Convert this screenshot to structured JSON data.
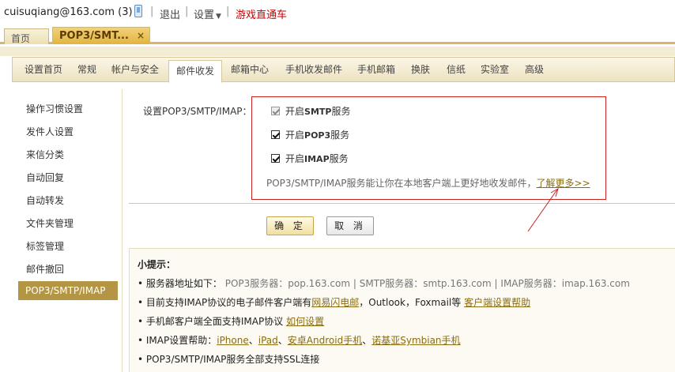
{
  "topbar": {
    "account": "cuisuqiang@163.com (3)",
    "logout": "退出",
    "settings": "设置",
    "game": "游戏直通车"
  },
  "window_tabs": [
    {
      "label": "首页"
    },
    {
      "label": "POP3/SMT..."
    }
  ],
  "settings_tabs": [
    "设置首页",
    "常规",
    "帐户与安全",
    "邮件收发",
    "邮箱中心",
    "手机收发邮件",
    "手机邮箱",
    "换肤",
    "信纸",
    "实验室",
    "高级"
  ],
  "left_nav": [
    "操作习惯设置",
    "发件人设置",
    "来信分类",
    "自动回复",
    "自动转发",
    "文件夹管理",
    "标签管理",
    "邮件撤回",
    "POP3/SMTP/IMAP"
  ],
  "form": {
    "label": "设置POP3/SMTP/IMAP：",
    "options": [
      {
        "prefix": "开启",
        "proto": "SMTP",
        "suffix": "服务",
        "checked": true,
        "disabled": true
      },
      {
        "prefix": "开启",
        "proto": "POP3",
        "suffix": "服务",
        "checked": true,
        "disabled": false
      },
      {
        "prefix": "开启",
        "proto": "IMAP",
        "suffix": "服务",
        "checked": true,
        "disabled": false
      }
    ],
    "desc": "POP3/SMTP/IMAP服务能让你在本地客户端上更好地收发邮件，",
    "more": "了解更多>>",
    "ok": "确 定",
    "cancel": "取 消"
  },
  "tips": {
    "title": "小提示：",
    "line1": {
      "prefix": "• 服务器地址如下：",
      "pop3": "POP3服务器：pop.163.com",
      "smtp": "SMTP服务器：smtp.163.com",
      "imap": "IMAP服务器：imap.163.com",
      "bar": "|"
    },
    "line2": {
      "prefix": "• 目前支持IMAP协议的电子邮件客户端有",
      "link1": "网易闪电邮",
      "mid": "，Outlook，Foxmail等",
      "link2": "客户端设置帮助"
    },
    "line3": {
      "prefix": "• 手机邮客户端全面支持IMAP协议",
      "link": "如何设置"
    },
    "line4": {
      "prefix": "• IMAP设置帮助：",
      "link1": "iPhone",
      "link2": "iPad",
      "link3": "安卓Android手机",
      "link4": "诺基亚Symbian手机",
      "sep": "、"
    },
    "line5": "• POP3/SMTP/IMAP服务全部支持SSL连接"
  },
  "colors": {
    "accent": "#b39544",
    "highlight_box": "#cc2222",
    "link": "#8a6d10"
  }
}
